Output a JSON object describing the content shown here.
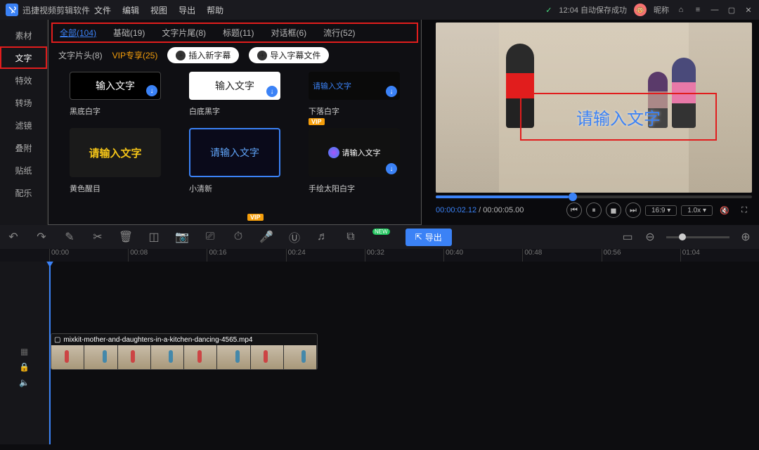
{
  "titlebar": {
    "app_name": "迅捷视频剪辑软件",
    "menu": [
      "文件",
      "编辑",
      "视图",
      "导出",
      "帮助"
    ],
    "autosave": "12:04 自动保存成功",
    "nickname": "昵称"
  },
  "sidebar": {
    "items": [
      {
        "label": "素材"
      },
      {
        "label": "文字",
        "active": true
      },
      {
        "label": "特效"
      },
      {
        "label": "转场"
      },
      {
        "label": "滤镜"
      },
      {
        "label": "叠附"
      },
      {
        "label": "贴纸"
      },
      {
        "label": "配乐"
      }
    ]
  },
  "library": {
    "tabs_row1": [
      {
        "label": "全部(104)",
        "active": true
      },
      {
        "label": "基础(19)"
      },
      {
        "label": "文字片尾(8)"
      },
      {
        "label": "标题(11)"
      },
      {
        "label": "对话框(6)"
      },
      {
        "label": "流行(52)"
      }
    ],
    "tabs_row2": {
      "t1": "文字片头(8)",
      "vip": "VIP专享(25)",
      "btn1": "插入新字幕",
      "btn2": "导入字幕文件"
    },
    "cards_row1": [
      {
        "thumb_text": "输入文字",
        "label": "黑底白字"
      },
      {
        "thumb_text": "输入文字",
        "label": "白底黑字"
      },
      {
        "thumb_text": "请输入文字",
        "label": "下落白字"
      }
    ],
    "cards_row2": [
      {
        "thumb_text": "请输入文字",
        "label": "黄色醒目"
      },
      {
        "thumb_text": "请输入文字",
        "label": "小清新"
      },
      {
        "thumb_text": "请输入文字",
        "label": "手绘太阳白字",
        "vip": true
      }
    ],
    "vip_tag": "VIP"
  },
  "preview": {
    "overlay_text": "请输入文字",
    "time_current": "00:00:02.12",
    "time_total": "00:00:05.00",
    "ratio": "16:9",
    "speed": "1.0x"
  },
  "toolbar": {
    "export": "导出"
  },
  "ruler": {
    "marks": [
      "00:00",
      "00:08",
      "00:16",
      "00:24",
      "00:32",
      "00:40",
      "00:48",
      "00:56",
      "01:04"
    ]
  },
  "clip": {
    "filename": "mixkit-mother-and-daughters-in-a-kitchen-dancing-4565.mp4"
  }
}
